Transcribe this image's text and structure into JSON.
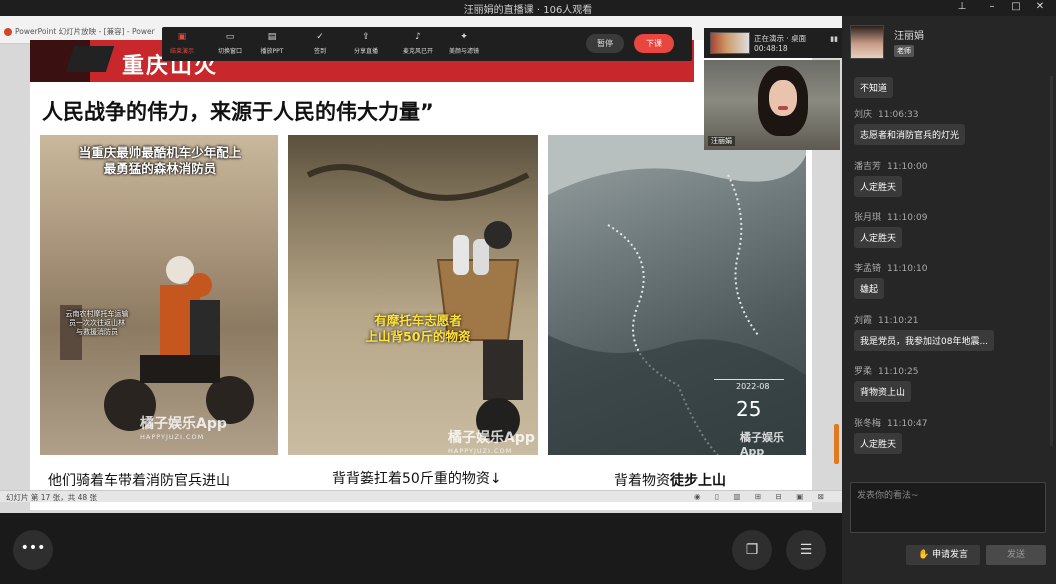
{
  "window": {
    "title": "汪丽娟的直播课 · 106人观看"
  },
  "powerpoint": {
    "title": "PowerPoint 幻灯片放映 - [兼容] - Power",
    "status": "幻灯片 第 17 张，共 48 张",
    "status_icons": "◉ ▯ ▥ ⊞ ⊟ ▣ ⊠"
  },
  "toolbar": {
    "tools": [
      {
        "icon": "▣",
        "label": "结束演示"
      },
      {
        "icon": "▭",
        "label": "切换窗口"
      },
      {
        "icon": "▤",
        "label": "播放PPT"
      },
      {
        "icon": "✓",
        "label": "签到"
      },
      {
        "icon": "⇪",
        "label": "分享直播"
      },
      {
        "icon": "♪",
        "label": "麦克风已开"
      },
      {
        "icon": "✦",
        "label": "美颜与滤镜"
      }
    ],
    "pause": "暂停",
    "end_class": "下课"
  },
  "presenting": {
    "label": "正在演示 · 桌面",
    "time": "00:48:18",
    "camera_name": "汪丽娟"
  },
  "slide": {
    "banner": "重庆山火",
    "heading": "人民战争的伟力，来源于人民的伟大力量”",
    "photo1_caption_top": "当重庆最帅最酷机车少年配上\n最勇猛的森林消防员",
    "photo1_small": "云南农村摩托车运输\n员一次次往返山林\n与救援消防员",
    "photo2_caption": "有摩托车志愿者\n上山背50斤的物资",
    "photo3_date": "2022-08",
    "photo3_day": "25",
    "watermark": "橘子娱乐App",
    "watermark_sub": "HAPPYJUZI.COM",
    "caption1": "他们骑着车带着消防官兵进山",
    "caption2": "背背篓扛着50斤重的物资↓",
    "caption3_plain": "背着物资",
    "caption3_bold": "徒步上山"
  },
  "chat": {
    "host": {
      "name": "汪丽娟",
      "badge": "老师"
    },
    "messages": [
      {
        "name": "",
        "time": "",
        "text": "不知道"
      },
      {
        "name": "刘庆",
        "time": "11:06:33",
        "text": "志愿者和消防官兵的灯光"
      },
      {
        "name": "潘吉芳",
        "time": "11:10:00",
        "text": "人定胜天"
      },
      {
        "name": "张月琪",
        "time": "11:10:09",
        "text": "人定胜天"
      },
      {
        "name": "李孟锜",
        "time": "11:10:10",
        "text": "雄起"
      },
      {
        "name": "刘霞",
        "time": "11:10:21",
        "text": "我是党员，我参加过08年地震..."
      },
      {
        "name": "罗柔",
        "time": "11:10:25",
        "text": "背物资上山"
      },
      {
        "name": "张冬梅",
        "time": "11:10:47",
        "text": "人定胜天"
      }
    ],
    "input_placeholder": "发表你的看法~",
    "raise_hand": "申请发言",
    "send": "发送"
  },
  "colors": {
    "accent_red": "#e8463e",
    "banner_red": "#c8272b",
    "scroll_orange": "#e07a1e"
  },
  "icons": {
    "more": "more-icon",
    "screen": "screen-share-icon",
    "list": "list-settings-icon",
    "hand": "raise-hand-icon"
  }
}
